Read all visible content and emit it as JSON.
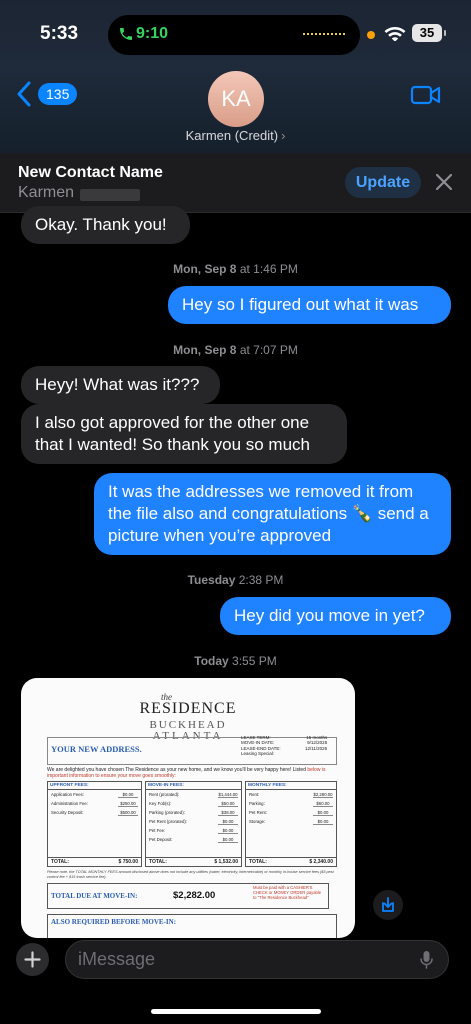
{
  "status_bar": {
    "time": "5:33",
    "call_time": "9:10",
    "battery": "35"
  },
  "nav": {
    "back_count": "135",
    "avatar_initials": "KA",
    "contact_name": "Karmen (Credit)",
    "contact_chevron": "›"
  },
  "banner": {
    "title": "New Contact Name",
    "subtitle": "Karmen",
    "update_label": "Update"
  },
  "messages": [
    {
      "type": "received",
      "text": "Okay. Thank you!"
    },
    {
      "type": "timestamp",
      "day": "Mon, Sep 8",
      "time": "at 1:46 PM"
    },
    {
      "type": "sent",
      "text": "Hey so I figured out what it was"
    },
    {
      "type": "timestamp",
      "day": "Mon, Sep 8",
      "time": "at 7:07 PM"
    },
    {
      "type": "received",
      "text": "Heyy! What was it???"
    },
    {
      "type": "received",
      "text": "I also got approved for the other one that I wanted! So thank you so much"
    },
    {
      "type": "sent",
      "text": "It was the addresses we removed it from the file also and congratulations 🍾 send a picture when you’re approved"
    },
    {
      "type": "timestamp",
      "day": "Tuesday",
      "time": "2:38 PM"
    },
    {
      "type": "sent",
      "text": "Hey did you move in yet?"
    },
    {
      "type": "timestamp",
      "day": "Today",
      "time": "3:55 PM"
    }
  ],
  "attachment": {
    "logo_the": "the",
    "logo_main": "RESIDENCE",
    "logo_loc1": "BUCKHEAD",
    "logo_loc2": "ATLANTA",
    "address_title": "YOUR NEW ADDRESS.",
    "lease_labels": "LEASE TERM:\nMOVE-IN DATE:\nLEASE-END DATE:\nLeasing Special:",
    "lease_values": "15 months\n9/12/2025\n12/11/2026",
    "intro": "We are delighted you have chosen The Residence as your new home, and we know you'll be very happy here! Listed",
    "intro_red": "below is important information to ensure your move goes smoothly:",
    "upfront": {
      "header": "UPFRONT FEES:",
      "rows": [
        [
          "Application Fees:",
          "$0.00"
        ],
        [
          "Administration Fee:",
          "$250.00"
        ],
        [
          "Security Deposit:",
          "$500.00"
        ]
      ],
      "total_label": "TOTAL:",
      "total": "$ 750.00"
    },
    "movein": {
      "header": "MOVE-IN FEES:",
      "rows": [
        [
          "Rent (prorated):",
          "$1,444.00"
        ],
        [
          "Key Fob(s):",
          "$50.00"
        ],
        [
          "Parking (prorated):",
          "$38.00"
        ],
        [
          "Pet Rent (prorated):",
          "$0.00"
        ],
        [
          "Pet Fee:",
          "$0.00"
        ],
        [
          "Pet Deposit:",
          "$0.00"
        ]
      ],
      "total_label": "TOTAL:",
      "total": "$ 1,532.00"
    },
    "monthly": {
      "header": "MONTHLY FEES:",
      "rows": [
        [
          "Rent:",
          "$2,280.00"
        ],
        [
          "Parking:",
          "$60.00"
        ],
        [
          "Pet Rent:",
          "$0.00"
        ],
        [
          "Storage:",
          "$0.00"
        ]
      ],
      "total_label": "TOTAL:",
      "total": "$ 2,340.00"
    },
    "note": "Please note, the TOTAL MONTHLY FEES amount disclosed above does not include any utilities (water, electricity, internet/cable) or monthly in-house service fees ($5 pest control fee + $15 trash service fee).",
    "due_label": "TOTAL DUE AT MOVE-IN:",
    "due_value": "$2,282.00",
    "due_note": "Must be paid with a CASHIER'S CHECK or MONEY ORDER payable to \"The Residence Buckhead\"",
    "also_label": "ALSO REQUIRED BEFORE MOVE-IN:"
  },
  "composer": {
    "placeholder": "iMessage"
  },
  "icons": [
    "phone-icon",
    "wifi-icon",
    "back-chevron-icon",
    "video-call-icon",
    "close-icon",
    "save-download-icon",
    "plus-icon",
    "microphone-icon"
  ],
  "colors": {
    "sent_bubble": "#1f82ff",
    "received_bubble": "#262628",
    "accent": "#0a84ff",
    "call_green": "#35d35f"
  }
}
